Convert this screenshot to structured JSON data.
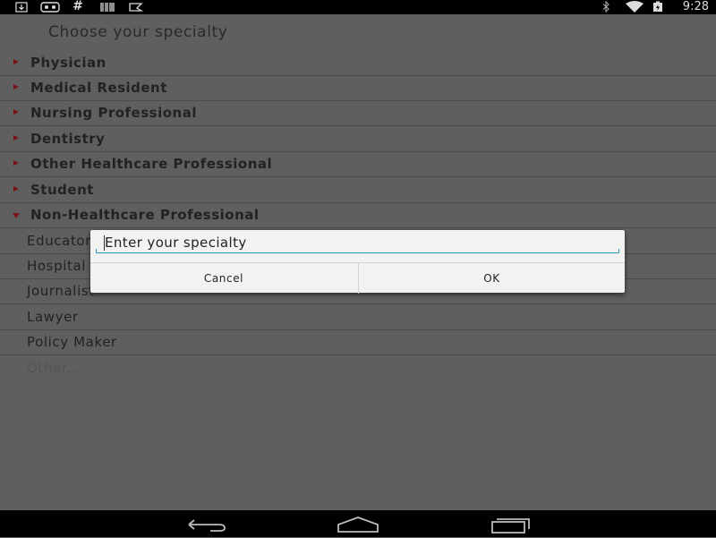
{
  "status_bar": {
    "time": "9:28",
    "left_icons": [
      "download-icon",
      "game-controller-icon",
      "hashtag-icon",
      "barcode-icon",
      "notes-icon"
    ],
    "right_icons": [
      "bluetooth-icon",
      "wifi-icon",
      "battery-icon"
    ]
  },
  "page": {
    "title": "Choose your specialty"
  },
  "categories": [
    {
      "label": "Physician",
      "expanded": false
    },
    {
      "label": "Medical Resident",
      "expanded": false
    },
    {
      "label": "Nursing Professional",
      "expanded": false
    },
    {
      "label": "Dentistry",
      "expanded": false
    },
    {
      "label": "Other Healthcare Professional",
      "expanded": false
    },
    {
      "label": "Student",
      "expanded": false
    },
    {
      "label": "Non-Healthcare Professional",
      "expanded": true
    }
  ],
  "subitems": [
    {
      "label": "Educator"
    },
    {
      "label": "Hospital"
    },
    {
      "label": "Journalist"
    },
    {
      "label": "Lawyer"
    },
    {
      "label": "Policy Maker"
    },
    {
      "label": "Other..."
    }
  ],
  "dialog": {
    "input_placeholder": "Enter your specialty",
    "input_value": "",
    "cancel_label": "Cancel",
    "ok_label": "OK",
    "accent_color": "#2f9bbd"
  },
  "nav_bar": {
    "icons": [
      "back-icon",
      "home-icon",
      "recent-apps-icon"
    ]
  }
}
